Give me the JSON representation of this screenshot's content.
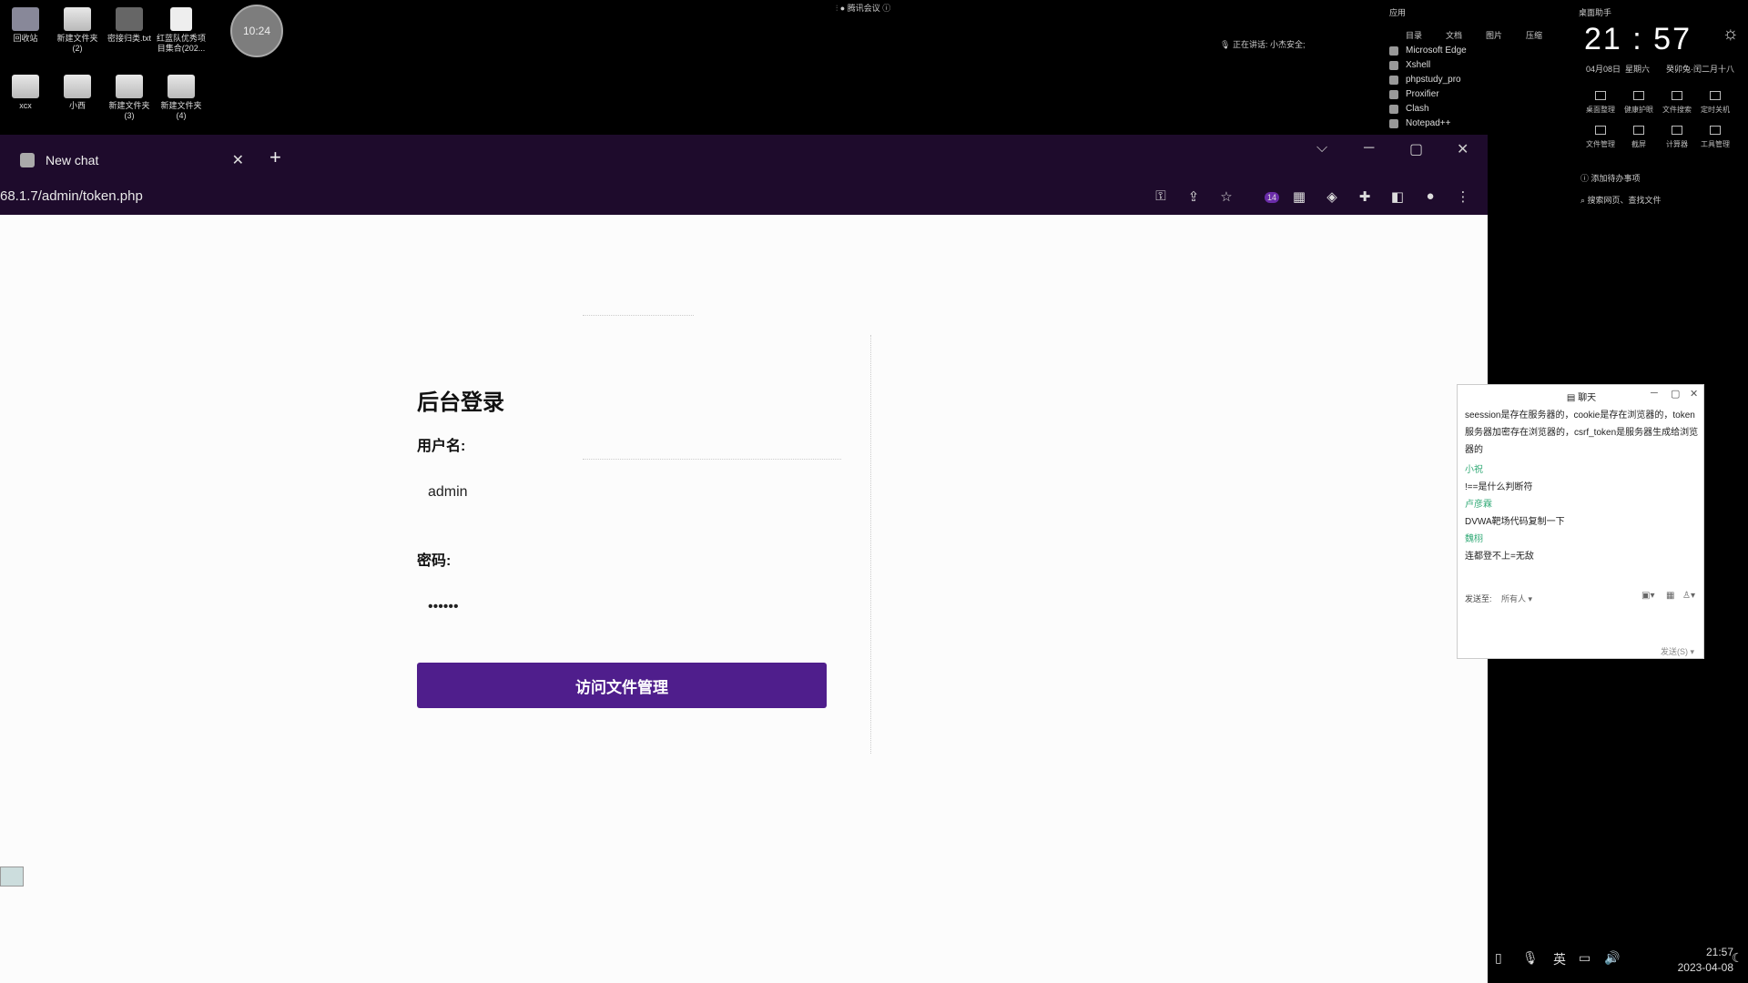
{
  "desktop": {
    "icons": [
      {
        "label": "回收站"
      },
      {
        "label": "新建文件夹\n(2)"
      },
      {
        "label": "密接归类.txt"
      },
      {
        "label": "红蓝队优秀项\n目集合(202..."
      },
      {
        "label": "xcx"
      },
      {
        "label": "小西"
      },
      {
        "label": "新建文件夹\n(3)"
      },
      {
        "label": "新建文件夹\n(4)"
      }
    ],
    "clock_badge": "10:24",
    "meeting_title": "腾讯会议",
    "speaking_label": "正在讲话: 小杰安全;"
  },
  "start_panel": {
    "header": "应用",
    "tabs": [
      "目录",
      "文档",
      "图片",
      "压缩"
    ],
    "apps": [
      "Microsoft Edge",
      "Xshell",
      "phpstudy_pro",
      "Proxifier",
      "Clash",
      "Notepad++"
    ]
  },
  "widget": {
    "title": "桌面助手",
    "time": "21 : 57",
    "date": "04月08日",
    "weekday": "星期六",
    "lunar": "癸卯兔·闰二月十八",
    "quick": [
      "桌面整理",
      "健康护眼",
      "文件搜索",
      "定时关机",
      "文件管理",
      "截屏",
      "计算器",
      "工具管理"
    ],
    "todo": "添加待办事项",
    "search": "搜索网页、查找文件"
  },
  "browser": {
    "tab_title": "New chat",
    "url": "68.1.7/admin/token.php",
    "ext_badge": "14"
  },
  "page": {
    "title": "后台登录",
    "username_label": "用户名:",
    "username_value": "admin",
    "password_label": "密码:",
    "password_value": "••••••",
    "submit_label": "访问文件管理"
  },
  "chat": {
    "title": "聊天",
    "messages": [
      {
        "text": "seession是存在服务器的，cookie是存在浏览器的，token服务器加密存在浏览器的，csrf_token是服务器生成给浏览器的"
      },
      {
        "name": "小祝",
        "text": "!==是什么判断符"
      },
      {
        "name": "卢彦霖",
        "text": "DVWA靶场代码复制一下"
      },
      {
        "name": "魏栩",
        "text": "连都登不上=无敌"
      }
    ],
    "send_to_label": "发送至:",
    "send_to_value": "所有人",
    "send_button": "发送(S)"
  },
  "taskbar": {
    "ime": "英",
    "time": "21:57",
    "date": "2023-04-08"
  }
}
